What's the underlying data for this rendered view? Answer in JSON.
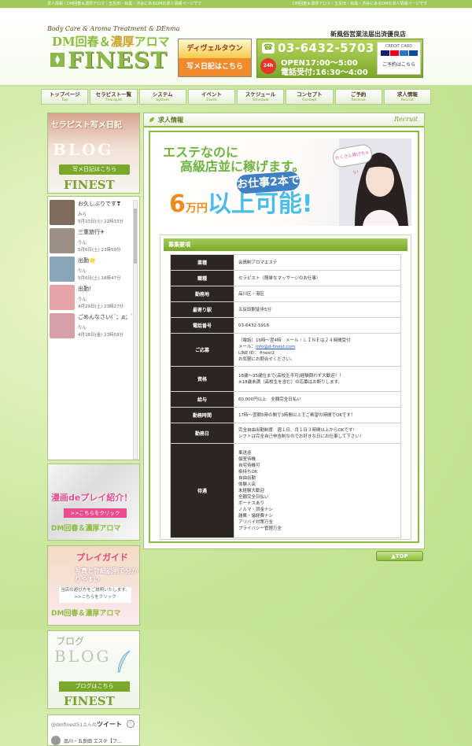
{
  "top_strip": {
    "left": "求人情報｜DM回春＆濃厚アロマ｜五反田・目黒・渋谷にあるDMの求人情報ページです",
    "right": "DM回春＆濃厚アロマ｜五反田・目黒・渋谷にあるDMの求人情報ページです"
  },
  "header": {
    "logo_sub": "Body Care & Aroma Treatment & DEnma",
    "logo_main_a": "DM回春",
    "logo_main_amp": "＆",
    "logo_main_b": "濃厚",
    "logo_main_c": "アロマ",
    "logo_finest": "FINEST",
    "photo_banner_top": "ディヴェルタウン",
    "photo_banner_bottom": "写メ日記はこちら",
    "tagline": "新風俗営業法届出済優良店",
    "phone_icon": "☎",
    "phone": "03-6432-5703",
    "open": "OPEN17:00～5:00",
    "tel_hours": "電話受付:16:30～4:00",
    "badge_24": "24h",
    "credit_title": "CREDIT CARD",
    "credit_link": "ご予約はこちら",
    "credit_colors": [
      "#1a1f71",
      "#eb001b",
      "#2e77bc",
      "#0e4c96"
    ]
  },
  "nav": [
    {
      "jp": "トップページ",
      "en": "Top"
    },
    {
      "jp": "セラピスト一覧",
      "en": "Therapist"
    },
    {
      "jp": "システム",
      "en": "System"
    },
    {
      "jp": "イベント",
      "en": "Event"
    },
    {
      "jp": "スケジュール",
      "en": "Schedule"
    },
    {
      "jp": "コンセプト",
      "en": "Concept"
    },
    {
      "jp": "ご予約",
      "en": "Reserve"
    },
    {
      "jp": "求人情報",
      "en": "Recruit"
    }
  ],
  "sidebar": {
    "blog_banner": {
      "title": "セラピスト写メ日記",
      "big": "BLOG",
      "button": "写メ日記はこちら",
      "finest": "FINEST"
    },
    "diary": [
      {
        "title": "お久しぶりです❣",
        "user": "みら",
        "date": "5月23日(火) 22時33分",
        "color": "#7d6b5c"
      },
      {
        "title": "三重旅行✈",
        "user": "りん",
        "date": "5月6日(土) 23時59分",
        "color": "#9b8f86"
      },
      {
        "title": "出勤🌟",
        "user": "りん",
        "date": "5月6日(土) 18時47分",
        "color": "#8aa4b8"
      },
      {
        "title": "出勤！",
        "user": "りん",
        "date": "4月29日(土) 23時27分",
        "color": "#e8a3a8"
      },
      {
        "title": "ごめんなさい(´；д；`)",
        "user": "りん",
        "date": "4月28日(金) 23時59分",
        "color": "#d7a0a6"
      }
    ],
    "manga_banner": {
      "t1": "漫画deプレイ紹介！",
      "t2": ">>こちらをクリック",
      "t3": "DM回春＆濃厚アロマ"
    },
    "guide_banner": {
      "t1": "プレイガイド",
      "t2": "写真と詳細説明で分かりやすい",
      "t3": "当店の遊び方をご説明いたします。>>こちらをクリック",
      "t4": "DM回春＆濃厚アロマ"
    },
    "blog2_banner": {
      "title": "ブログ",
      "big": "BLOG",
      "button": "ブログはこちら",
      "finest": "FINEST"
    },
    "tweets": {
      "handle": "@dmfinest51さんの",
      "label": "ツイート",
      "info": "i",
      "line": "品川・五反田 エステ【フ..."
    }
  },
  "main": {
    "section_title": "求人情報",
    "section_en": "Recruit",
    "banner": {
      "line1": "エステなのに",
      "line2": "高級店並に稼げます。",
      "pill": "お仕事2本で",
      "big_num": "6",
      "big_unit": "万円",
      "big_tail": "以上可能!",
      "speech": "たくさん稼げちゃう!"
    },
    "requirements_title": "募集要項",
    "requirements": [
      {
        "label": "業種",
        "value": "会員制アロマエステ"
      },
      {
        "label": "職種",
        "value": "セラピスト（簡単なマッサージのお仕事）"
      },
      {
        "label": "勤務地",
        "value": "品川区・港区"
      },
      {
        "label": "最寄り駅",
        "value": "五反田駅徒歩5分"
      },
      {
        "label": "電話番号",
        "value": "03-6432-5918"
      },
      {
        "label": "ご応募",
        "value": "（電話）16時～翌4時　メール・ＬＩＮＥは２４時間受付",
        "email_prefix": "メール：",
        "email": "info@d-finest.com",
        "line": "LINE ID：  finest2",
        "note": "お気軽にお問合せください。"
      },
      {
        "label": "資格",
        "value": "18歳～35歳位まで(高校生不可)経験問わず大歓迎！！",
        "note": "※18歳未満（高校生を含む）の応募はお断りします。"
      },
      {
        "label": "給与",
        "value": "60,000円以上　全額完全日払い"
      },
      {
        "label": "勤務時間",
        "value": "17時～翌朝5時の間で3時間以上でご希望の時間でOKです！"
      },
      {
        "label": "勤務日",
        "value": "完全自由出勤制度　週１日、月１日３時間以上からOKです！",
        "note": "シフトは完全自己申告制なのでお好きな日にお仕事して下さい！"
      },
      {
        "label": "待遇",
        "items": [
          "車送迎",
          "個室待機",
          "自宅待機可",
          "掛持ちOK",
          "自由出勤",
          "体験入店",
          "未経験大歓迎",
          "全額完全日払い",
          "ボーナスあり",
          "ノルマ・罰金ナシ",
          "雑費・諸経費ナシ",
          "アリバイ対策万全",
          "プライバシー管理万全"
        ]
      }
    ],
    "top_button": "▲TOP"
  }
}
